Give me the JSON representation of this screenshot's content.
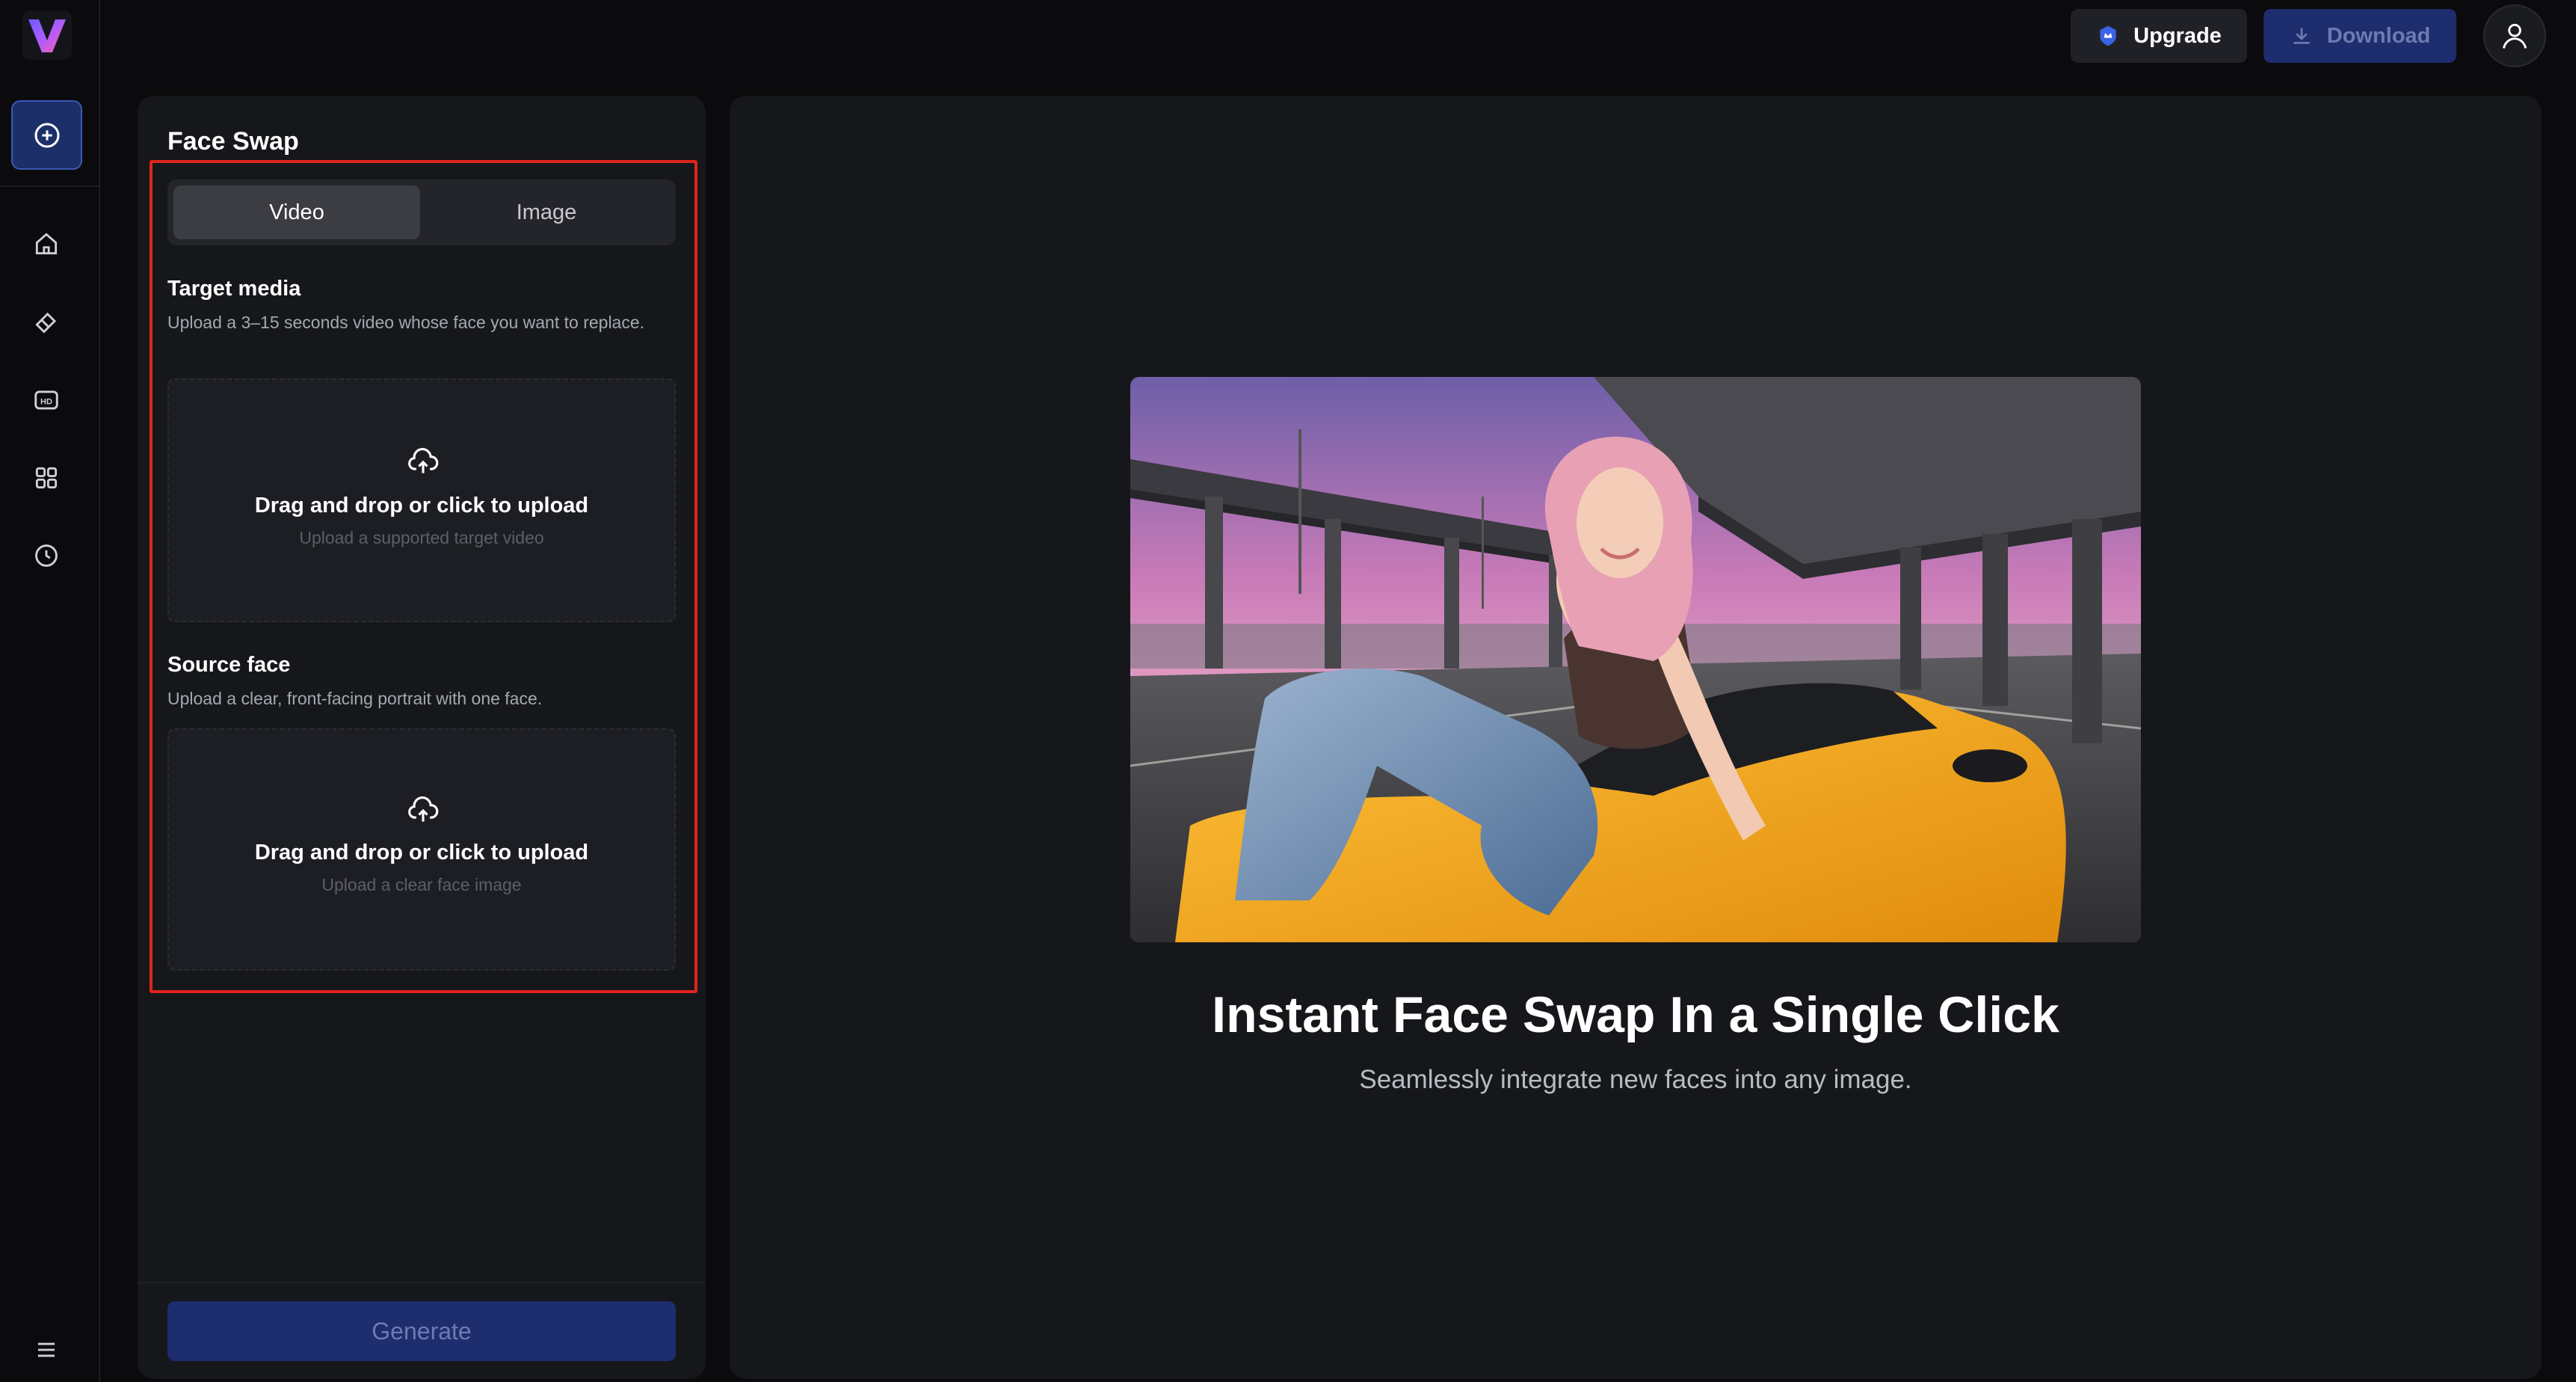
{
  "app": {
    "logo_icon": "v-logo-icon",
    "accent": "#3a58b4"
  },
  "sidebar": {
    "items": [
      {
        "icon": "plus-circle-icon",
        "label": "New"
      },
      {
        "icon": "home-icon"
      },
      {
        "icon": "eraser-icon"
      },
      {
        "icon": "hd-icon"
      },
      {
        "icon": "grid-icon"
      },
      {
        "icon": "clock-icon"
      },
      {
        "icon": "menu-icon"
      }
    ]
  },
  "topbar": {
    "upgrade_label": "Upgrade",
    "download_label": "Download"
  },
  "panel": {
    "title": "Face Swap",
    "tabs": [
      {
        "label": "Video",
        "active": true
      },
      {
        "label": "Image",
        "active": false
      }
    ],
    "target": {
      "label": "Target media",
      "description": "Upload a 3–15 seconds video whose face you want to replace.",
      "drop_title": "Drag and drop or click to upload",
      "drop_subtitle": "Upload a supported target video"
    },
    "source": {
      "label": "Source face",
      "description": "Upload a clear, front-facing portrait with one face.",
      "drop_title": "Drag and drop or click to upload",
      "drop_subtitle": "Upload a clear face image"
    },
    "generate_label": "Generate"
  },
  "main": {
    "hero_title": "Instant Face Swap In a Single Click",
    "hero_subtitle": "Seamlessly integrate new faces into any image."
  }
}
